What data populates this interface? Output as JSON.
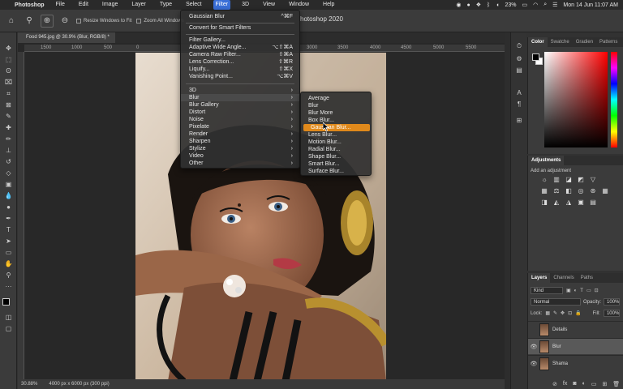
{
  "menubar": {
    "app_name": "Photoshop",
    "items": [
      "File",
      "Edit",
      "Image",
      "Layer",
      "Type",
      "Select",
      "Filter",
      "3D",
      "View",
      "Window",
      "Help"
    ],
    "battery": "23%",
    "clock": "Mon 14 Jun  11:07 AM"
  },
  "options_bar": {
    "resize_windows_label": "Resize Windows to Fit",
    "zoom_all_label": "Zoom All Windows",
    "app_title": "hotoshop 2020"
  },
  "document": {
    "tab_title": "Food 945.jpg @ 30.9% (Blur, RGB/8) *",
    "zoom": "30.88%",
    "doc_info": "4000 px x 6000 px (300 ppi)",
    "ruler_labels": [
      "1500",
      "1000",
      "500",
      "0",
      "500",
      "1000",
      "1500",
      "2000",
      "2500",
      "3000",
      "3500",
      "4000",
      "4500",
      "5000",
      "5500"
    ]
  },
  "filter_menu": {
    "top_items": [
      {
        "label": "Gaussian Blur",
        "shortcut": "^⌘F"
      },
      {
        "label": "Convert for Smart Filters",
        "shortcut": ""
      }
    ],
    "middle_items": [
      {
        "label": "Filter Gallery...",
        "shortcut": ""
      },
      {
        "label": "Adaptive Wide Angle...",
        "shortcut": "⌥⇧⌘A"
      },
      {
        "label": "Camera Raw Filter...",
        "shortcut": "⇧⌘A"
      },
      {
        "label": "Lens Correction...",
        "shortcut": "⇧⌘R"
      },
      {
        "label": "Liquify...",
        "shortcut": "⇧⌘X"
      },
      {
        "label": "Vanishing Point...",
        "shortcut": "⌥⌘V"
      }
    ],
    "sub_items": [
      "3D",
      "Blur",
      "Blur Gallery",
      "Distort",
      "Noise",
      "Pixelate",
      "Render",
      "Sharpen",
      "Stylize",
      "Video",
      "Other"
    ]
  },
  "blur_submenu": {
    "items": [
      "Average",
      "Blur",
      "Blur More",
      "Box Blur...",
      "Gaussian Blur...",
      "Lens Blur...",
      "Motion Blur...",
      "Radial Blur...",
      "Shape Blur...",
      "Smart Blur...",
      "Surface Blur..."
    ]
  },
  "color_panel": {
    "tabs": [
      "Color",
      "Swatche",
      "Gradien",
      "Patterns"
    ],
    "foreground": "#000000",
    "background": "#ffffff",
    "hue_color": "#ff0000"
  },
  "adjustments_panel": {
    "title": "Adjustments",
    "subtitle": "Add an adjustment"
  },
  "layers_panel": {
    "tabs": [
      "Layers",
      "Channels",
      "Paths"
    ],
    "kind_filter": "Kind",
    "blend_mode": "Normal",
    "opacity_label": "Opacity:",
    "opacity": "100%",
    "lock_label": "Lock:",
    "fill_label": "Fill:",
    "fill": "100%",
    "layers": [
      {
        "name": "Details",
        "visible": false,
        "selected": false
      },
      {
        "name": "Blur",
        "visible": true,
        "selected": true
      },
      {
        "name": "Shama",
        "visible": true,
        "selected": false
      }
    ]
  }
}
